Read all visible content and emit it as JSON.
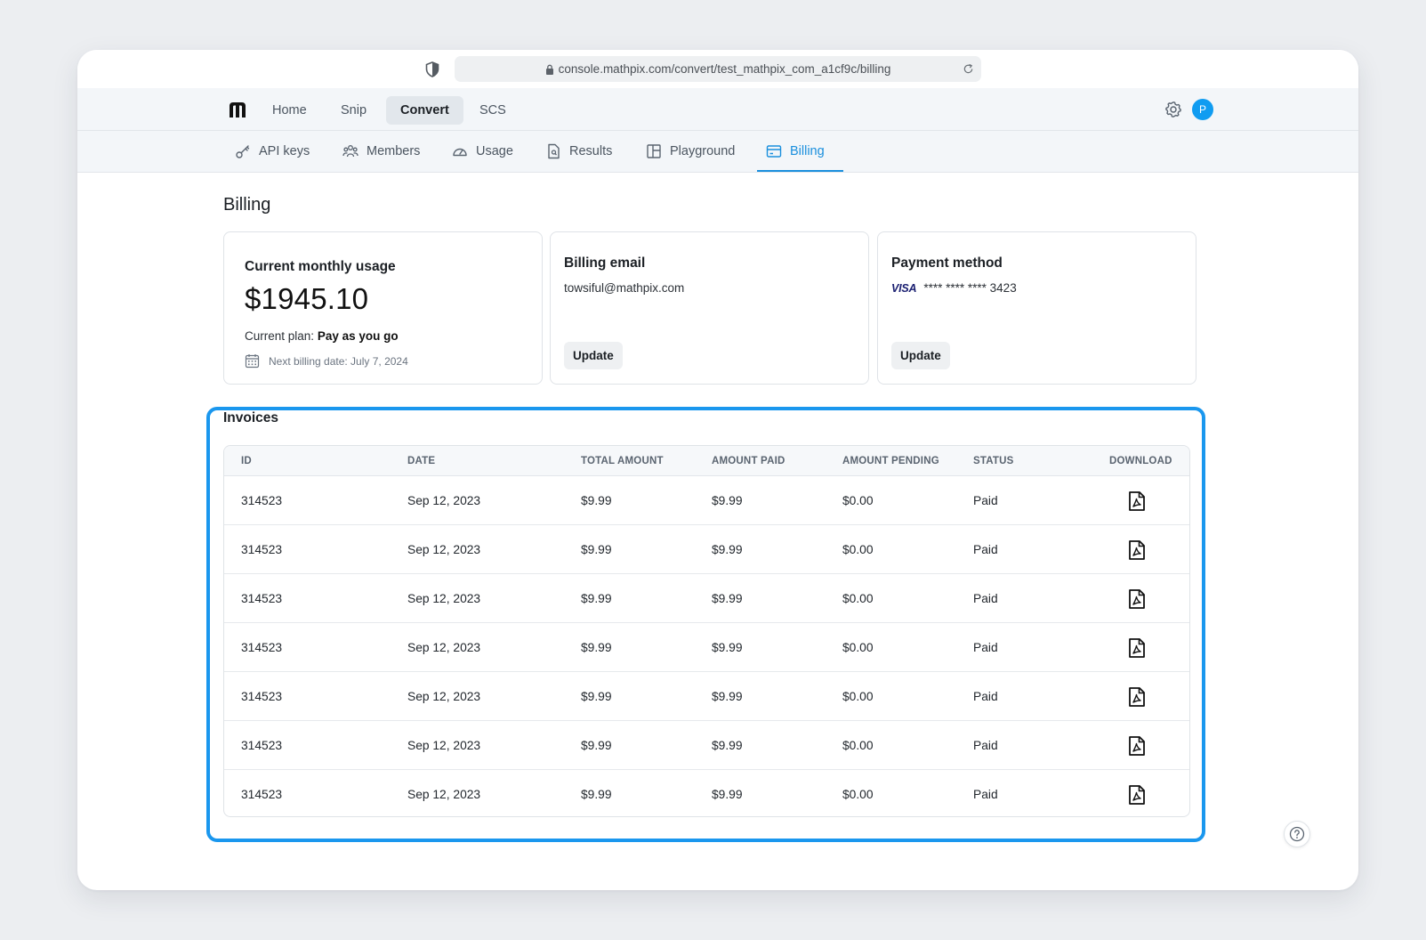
{
  "browser": {
    "url": "console.mathpix.com/convert/test_mathpix_com_a1cf9c/billing"
  },
  "topnav": {
    "tabs": [
      {
        "label": "Home"
      },
      {
        "label": "Snip"
      },
      {
        "label": "Convert",
        "active": true
      },
      {
        "label": "SCS"
      }
    ],
    "avatar_initial": "P"
  },
  "subnav": {
    "tabs": [
      {
        "label": "API keys",
        "icon": "key-icon"
      },
      {
        "label": "Members",
        "icon": "members-icon"
      },
      {
        "label": "Usage",
        "icon": "gauge-icon"
      },
      {
        "label": "Results",
        "icon": "document-icon"
      },
      {
        "label": "Playground",
        "icon": "layout-icon"
      },
      {
        "label": "Billing",
        "icon": "billing-icon",
        "active": true
      }
    ]
  },
  "page": {
    "title": "Billing"
  },
  "usage_card": {
    "title": "Current monthly usage",
    "amount": "$1945.10",
    "plan_label": "Current plan:",
    "plan_value": "Pay as you go",
    "next_billing": "Next billing date: July 7, 2024"
  },
  "email_card": {
    "title": "Billing email",
    "email": "towsiful@mathpix.com",
    "button": "Update"
  },
  "payment_card": {
    "title": "Payment method",
    "brand": "VISA",
    "card_number": "**** **** **** 3423",
    "button": "Update"
  },
  "invoices": {
    "title": "Invoices",
    "columns": [
      "ID",
      "DATE",
      "TOTAL AMOUNT",
      "AMOUNT PAID",
      "AMOUNT PENDING",
      "STATUS",
      "DOWNLOAD"
    ],
    "rows": [
      {
        "id": "314523",
        "date": "Sep 12, 2023",
        "total": "$9.99",
        "paid": "$9.99",
        "pending": "$0.00",
        "status": "Paid"
      },
      {
        "id": "314523",
        "date": "Sep 12, 2023",
        "total": "$9.99",
        "paid": "$9.99",
        "pending": "$0.00",
        "status": "Paid"
      },
      {
        "id": "314523",
        "date": "Sep 12, 2023",
        "total": "$9.99",
        "paid": "$9.99",
        "pending": "$0.00",
        "status": "Paid"
      },
      {
        "id": "314523",
        "date": "Sep 12, 2023",
        "total": "$9.99",
        "paid": "$9.99",
        "pending": "$0.00",
        "status": "Paid"
      },
      {
        "id": "314523",
        "date": "Sep 12, 2023",
        "total": "$9.99",
        "paid": "$9.99",
        "pending": "$0.00",
        "status": "Paid"
      },
      {
        "id": "314523",
        "date": "Sep 12, 2023",
        "total": "$9.99",
        "paid": "$9.99",
        "pending": "$0.00",
        "status": "Paid"
      },
      {
        "id": "314523",
        "date": "Sep 12, 2023",
        "total": "$9.99",
        "paid": "$9.99",
        "pending": "$0.00",
        "status": "Paid"
      }
    ]
  },
  "colors": {
    "accent": "#1a8fdd",
    "highlight_frame": "#1a97ee",
    "avatar": "#109cf1"
  }
}
